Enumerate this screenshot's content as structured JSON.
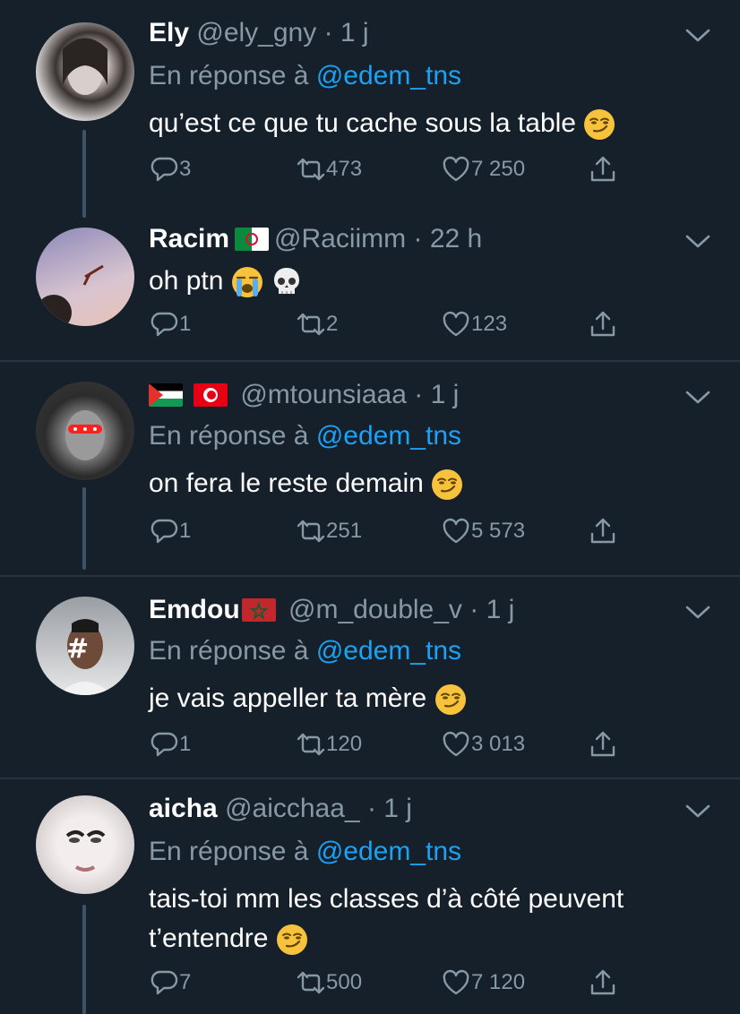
{
  "tweets": [
    {
      "name": "Ely",
      "handle": "@ely_gny",
      "time": "· 1 j",
      "reply_prefix": "En réponse à",
      "reply_mention": "@edem_tns",
      "text": "qu’est ce que tu cache sous la table",
      "replies": "3",
      "retweets": "473",
      "likes": "7 250"
    },
    {
      "name": "Racim",
      "handle": "@Raciimm",
      "time": "· 22 h",
      "text": "oh ptn",
      "replies": "1",
      "retweets": "2",
      "likes": "123"
    },
    {
      "name": "",
      "handle": "@mtounsiaaa",
      "time": "· 1 j",
      "reply_prefix": "En réponse à",
      "reply_mention": "@edem_tns",
      "text": "on fera le reste demain",
      "replies": "1",
      "retweets": "251",
      "likes": "5 573"
    },
    {
      "name": "Emdou",
      "handle": "@m_double_v",
      "time": "· 1 j",
      "reply_prefix": "En réponse à",
      "reply_mention": "@edem_tns",
      "text": "je vais appeller ta mère",
      "replies": "1",
      "retweets": "120",
      "likes": "3 013"
    },
    {
      "name": "aicha",
      "handle": "@aicchaa_",
      "time": "· 1 j",
      "reply_prefix": "En réponse à",
      "reply_mention": "@edem_tns",
      "text_line1": "tais-toi mm les classes d’à côté peuvent",
      "text_line2": "t’entendre",
      "replies": "7",
      "retweets": "500",
      "likes": "7 120"
    }
  ],
  "colors": {
    "background": "#15202b",
    "secondary_text": "#8899a6",
    "mention": "#1da1f2",
    "divider": "#263340"
  },
  "icons": [
    "reply-icon",
    "retweet-icon",
    "like-icon",
    "share-icon",
    "chevron-down-icon",
    "smirk-emoji",
    "crying-emoji",
    "skull-emoji",
    "flag-algeria",
    "flag-palestine",
    "flag-tunisia",
    "flag-morocco"
  ]
}
